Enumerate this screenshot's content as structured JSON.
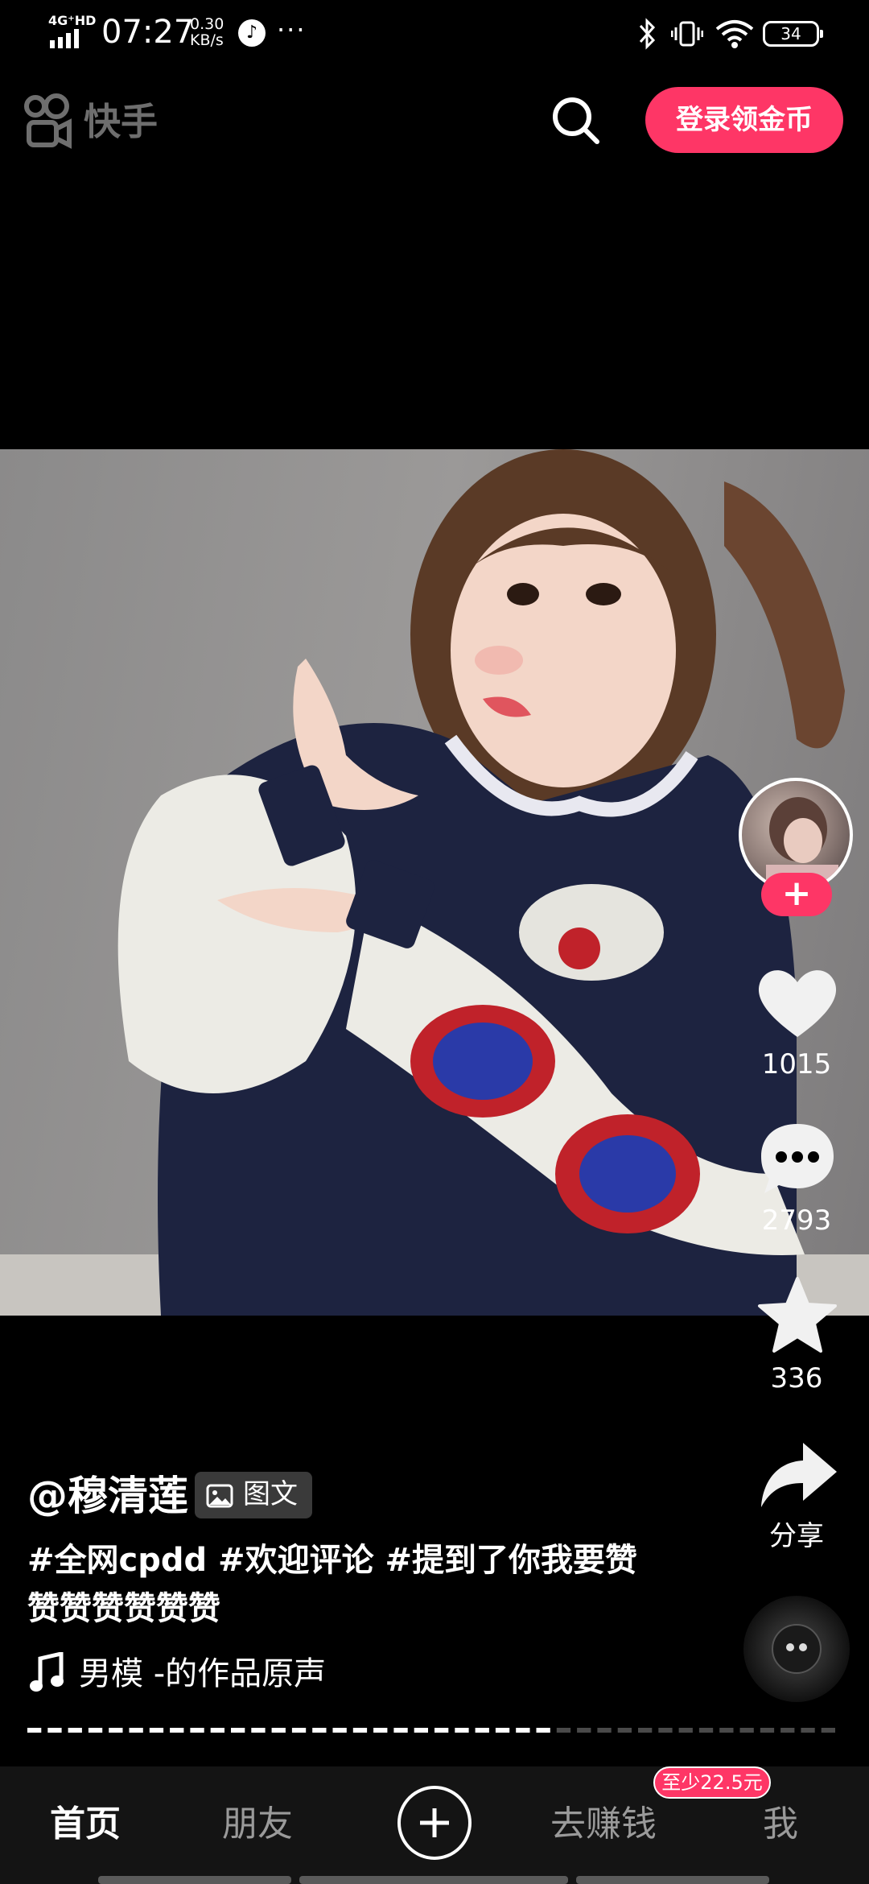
{
  "status_bar": {
    "network": "4G⁺HD",
    "time": "07:27",
    "speed_value": "0.30",
    "speed_unit": "KB/s",
    "more": "···",
    "battery": "34"
  },
  "header": {
    "app_name": "快手",
    "login_button": "登录领金币"
  },
  "post": {
    "author": "@穆清莲",
    "type_badge": "图文",
    "description": "#全网cpdd #欢迎评论 #提到了你我要赞赞赞赞赞赞赞",
    "music": "男模 -的作品原声"
  },
  "actions": {
    "follow": "+",
    "likes": "1015",
    "comments": "2793",
    "favorites": "336",
    "share": "分享"
  },
  "bottom_nav": {
    "home": "首页",
    "friends": "朋友",
    "earn": "去赚钱",
    "earn_badge": "至少22.5元",
    "me": "我"
  },
  "colors": {
    "accent": "#fe3666",
    "background": "#000000"
  }
}
